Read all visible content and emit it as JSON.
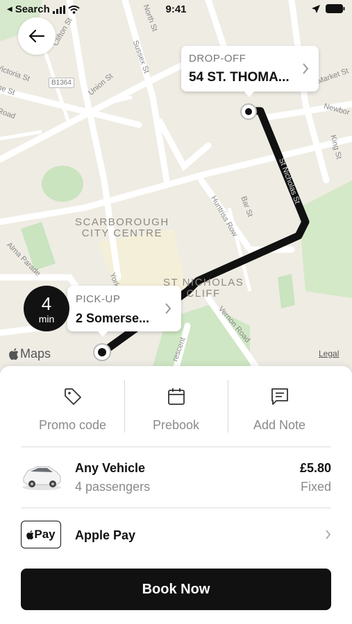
{
  "status_bar": {
    "back_app": "Search",
    "time": "9:41"
  },
  "map": {
    "labels": {
      "city_centre_1": "SCARBOROUGH",
      "city_centre_2": "CITY CENTRE",
      "cliff_1": "ST NICHOLAS",
      "cliff_2": "CLIFF",
      "road_b1364": "B1364",
      "clifton_st": "Clifton St",
      "north_st": "North St",
      "sussex_st": "Sussex St",
      "union_st": "Union St",
      "victoria_st": "Victoria St",
      "market_st": "Market St",
      "newborough": "Newbor",
      "king_st": "King St",
      "st_nicholas_st": "St Nicholas St",
      "bar_st": "Bar St",
      "huntriss_row": "Huntriss Row",
      "alma_parade": "Alma Parade",
      "vernon_road": "Vernon Road",
      "crescent": "rescent",
      "york": "York",
      "road": "Road",
      "ne_st": "ne St"
    },
    "maps_brand": "Maps",
    "legal": "Legal",
    "dropoff": {
      "label": "DROP-OFF",
      "address": "54 ST. THOMA..."
    },
    "pickup": {
      "label": "PICK-UP",
      "address": "2 Somerse..."
    },
    "eta": {
      "value": "4",
      "unit": "min"
    }
  },
  "options": [
    {
      "icon": "tag-icon",
      "label": "Promo code"
    },
    {
      "icon": "calendar-icon",
      "label": "Prebook"
    },
    {
      "icon": "note-icon",
      "label": "Add Note"
    }
  ],
  "vehicle": {
    "name": "Any Vehicle",
    "capacity": "4 passengers",
    "price": "£5.80",
    "price_type": "Fixed"
  },
  "payment": {
    "badge": "Pay",
    "method": "Apple Pay"
  },
  "cta": {
    "label": "Book Now"
  },
  "colors": {
    "accent": "#111111",
    "route": "#111111",
    "map_bg": "#efece4",
    "park": "#c9e4bf"
  }
}
